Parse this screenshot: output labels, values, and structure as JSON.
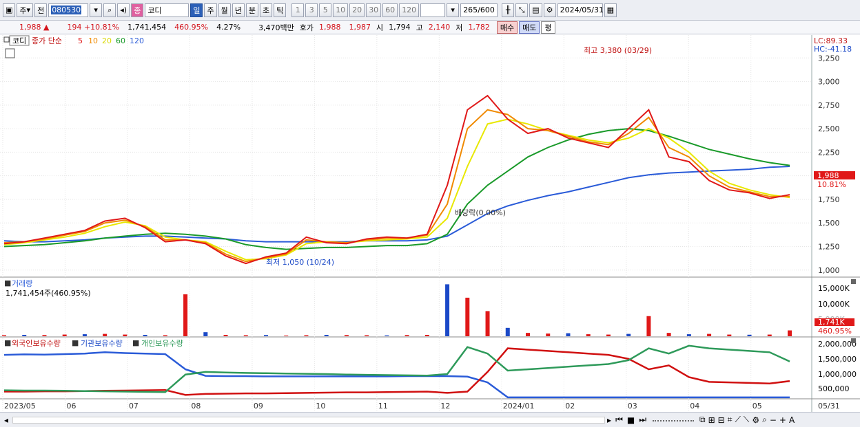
{
  "toolbar": {
    "market": "주",
    "prev": "전",
    "code": "080530",
    "stock_name": "코디",
    "name_tag": "종",
    "periods": [
      "일",
      "주",
      "월",
      "년",
      "분",
      "초",
      "틱"
    ],
    "selected_period": "일",
    "intervals": [
      "1",
      "3",
      "5",
      "10",
      "20",
      "30",
      "60",
      "120"
    ],
    "count": "265",
    "count_total": "/600",
    "date": "2024/05/31"
  },
  "quote": {
    "price": "1,988",
    "change": "194",
    "change_rate": "+10.81%",
    "volume": "1,741,454",
    "volume_rate": "460.95%",
    "turnover": "4.27%",
    "amount": "3,470백만",
    "ask_label": "호가",
    "ask": "1,988",
    "bid": "1,987",
    "open_label": "시",
    "open": "1,794",
    "high_label": "고",
    "high": "2,140",
    "low_label": "저",
    "low": "1,782",
    "buy_label": "매수",
    "sell_label": "매도",
    "eval_label": "평"
  },
  "price_panel": {
    "stock_tab": "코디",
    "ma_title": "종가 단순",
    "ma_periods": [
      "5",
      "10",
      "20",
      "60",
      "120"
    ],
    "lc": "LC:89.33",
    "hc": "HC:-41.18",
    "current_price": "1,988",
    "current_rate": "10.81%",
    "annotation_high": "최고 3,380 (03/29)",
    "annotation_low": "최저 1,050 (10/24)",
    "annotation_div": "배당락(0.00%)"
  },
  "volume_panel": {
    "title": "거래량",
    "value": "1,741,454주(460.95%)",
    "current": "1,741K",
    "current_rate": "460.95%",
    "ticks": [
      "15,000K",
      "10,000K",
      "5,000K"
    ]
  },
  "holder_panel": {
    "legend": [
      "외국인보유수량",
      "기관보유수량",
      "개인보유수량"
    ],
    "ticks": [
      "2,000,000",
      "1,500,000",
      "1,000,000",
      "500,000"
    ]
  },
  "x_axis": [
    "2023/05",
    "06",
    "07",
    "08",
    "09",
    "10",
    "11",
    "12",
    "2024/01",
    "02",
    "03",
    "04",
    "05",
    "05/31"
  ],
  "colors": {
    "ma5": "#E01818",
    "ma10": "#F08A00",
    "ma20": "#E8E800",
    "ma60": "#1A9A2A",
    "ma120": "#2A5BD8",
    "up": "#E01818",
    "down": "#1B49C7",
    "foreign": "#2A5BD8",
    "inst": "#D01010",
    "retail": "#2E9A5A"
  },
  "chart_data": [
    {
      "type": "line",
      "title": "코디",
      "y_ticks": [
        1000,
        1250,
        1500,
        1750,
        2000,
        2250,
        2500,
        2750,
        3000,
        3250
      ],
      "ylim": [
        940,
        3420
      ],
      "x_labels": [
        "2023/05",
        "06",
        "07",
        "08",
        "09",
        "10",
        "11",
        "12",
        "2024/01",
        "02",
        "03",
        "04",
        "05"
      ],
      "series": [
        {
          "name": "5",
          "values": [
            1280,
            1300,
            1340,
            1380,
            1420,
            1520,
            1550,
            1450,
            1300,
            1320,
            1280,
            1150,
            1070,
            1140,
            1180,
            1350,
            1290,
            1280,
            1330,
            1350,
            1340,
            1380,
            1900,
            2700,
            2850,
            2600,
            2450,
            2500,
            2400,
            2350,
            2300,
            2500,
            2700,
            2200,
            2150,
            1950,
            1850,
            1820,
            1760,
            1800
          ]
        },
        {
          "name": "10",
          "values": [
            1290,
            1300,
            1330,
            1370,
            1410,
            1500,
            1530,
            1460,
            1320,
            1320,
            1290,
            1170,
            1090,
            1130,
            1170,
            1320,
            1300,
            1290,
            1320,
            1340,
            1340,
            1370,
            1700,
            2500,
            2700,
            2650,
            2500,
            2480,
            2420,
            2360,
            2330,
            2450,
            2620,
            2300,
            2200,
            2000,
            1880,
            1830,
            1780,
            1780
          ]
        },
        {
          "name": "20",
          "values": [
            1270,
            1290,
            1320,
            1350,
            1390,
            1460,
            1510,
            1470,
            1350,
            1320,
            1300,
            1200,
            1110,
            1120,
            1160,
            1280,
            1300,
            1290,
            1310,
            1320,
            1330,
            1350,
            1550,
            2100,
            2550,
            2600,
            2550,
            2480,
            2430,
            2380,
            2350,
            2400,
            2500,
            2400,
            2250,
            2050,
            1920,
            1850,
            1800,
            1770
          ]
        },
        {
          "name": "60",
          "values": [
            1250,
            1260,
            1270,
            1290,
            1310,
            1340,
            1360,
            1380,
            1390,
            1380,
            1360,
            1330,
            1270,
            1240,
            1220,
            1230,
            1240,
            1240,
            1250,
            1260,
            1260,
            1280,
            1380,
            1700,
            1900,
            2050,
            2200,
            2300,
            2380,
            2440,
            2480,
            2500,
            2480,
            2420,
            2350,
            2280,
            2230,
            2180,
            2140,
            2110
          ]
        },
        {
          "name": "120",
          "values": [
            1310,
            1300,
            1300,
            1310,
            1320,
            1340,
            1350,
            1360,
            1360,
            1350,
            1340,
            1330,
            1310,
            1300,
            1300,
            1300,
            1300,
            1300,
            1310,
            1310,
            1310,
            1320,
            1360,
            1480,
            1600,
            1680,
            1740,
            1790,
            1830,
            1880,
            1930,
            1980,
            2010,
            2030,
            2040,
            2050,
            2060,
            2070,
            2090,
            2100
          ]
        }
      ]
    },
    {
      "type": "bar",
      "title": "거래량",
      "ylim": [
        0,
        16000000
      ],
      "values": [
        300000,
        400000,
        350000,
        500000,
        600000,
        700000,
        500000,
        400000,
        300000,
        12500000,
        1200000,
        400000,
        300000,
        350000,
        200000,
        300000,
        400000,
        350000,
        300000,
        250000,
        350000,
        400000,
        15500000,
        11500000,
        7500000,
        2500000,
        1000000,
        800000,
        900000,
        600000,
        500000,
        700000,
        6000000,
        1000000,
        600000,
        700000,
        500000,
        450000,
        500000,
        1741454
      ]
    },
    {
      "type": "line",
      "title": "보유수량",
      "ylim": [
        0,
        2100000
      ],
      "series": [
        {
          "name": "외국인보유수량",
          "values": [
            1650000,
            1670000,
            1660000,
            1680000,
            1700000,
            1750000,
            1720000,
            1700000,
            1680000,
            1100000,
            850000,
            840000,
            840000,
            830000,
            830000,
            830000,
            830000,
            830000,
            830000,
            830000,
            840000,
            840000,
            840000,
            820000,
            600000,
            30000,
            30000,
            30000,
            30000,
            30000,
            30000,
            30000,
            30000,
            30000,
            30000,
            30000,
            30000,
            30000,
            30000,
            30000
          ]
        },
        {
          "name": "기관보유수량",
          "values": [
            250000,
            250000,
            260000,
            260000,
            270000,
            280000,
            290000,
            300000,
            310000,
            120000,
            160000,
            170000,
            180000,
            180000,
            190000,
            200000,
            210000,
            220000,
            220000,
            230000,
            240000,
            250000,
            200000,
            250000,
            1000000,
            1900000,
            1850000,
            1800000,
            1750000,
            1700000,
            1650000,
            1500000,
            1100000,
            1250000,
            800000,
            620000,
            600000,
            580000,
            560000,
            650000
          ]
        },
        {
          "name": "개인보유수량",
          "values": [
            300000,
            290000,
            290000,
            280000,
            270000,
            260000,
            250000,
            240000,
            230000,
            900000,
            1000000,
            980000,
            960000,
            950000,
            940000,
            930000,
            920000,
            900000,
            890000,
            880000,
            870000,
            860000,
            920000,
            1950000,
            1700000,
            1050000,
            1100000,
            1150000,
            1200000,
            1250000,
            1300000,
            1450000,
            1900000,
            1700000,
            2000000,
            1900000,
            1850000,
            1800000,
            1750000,
            1400000
          ]
        }
      ]
    }
  ]
}
